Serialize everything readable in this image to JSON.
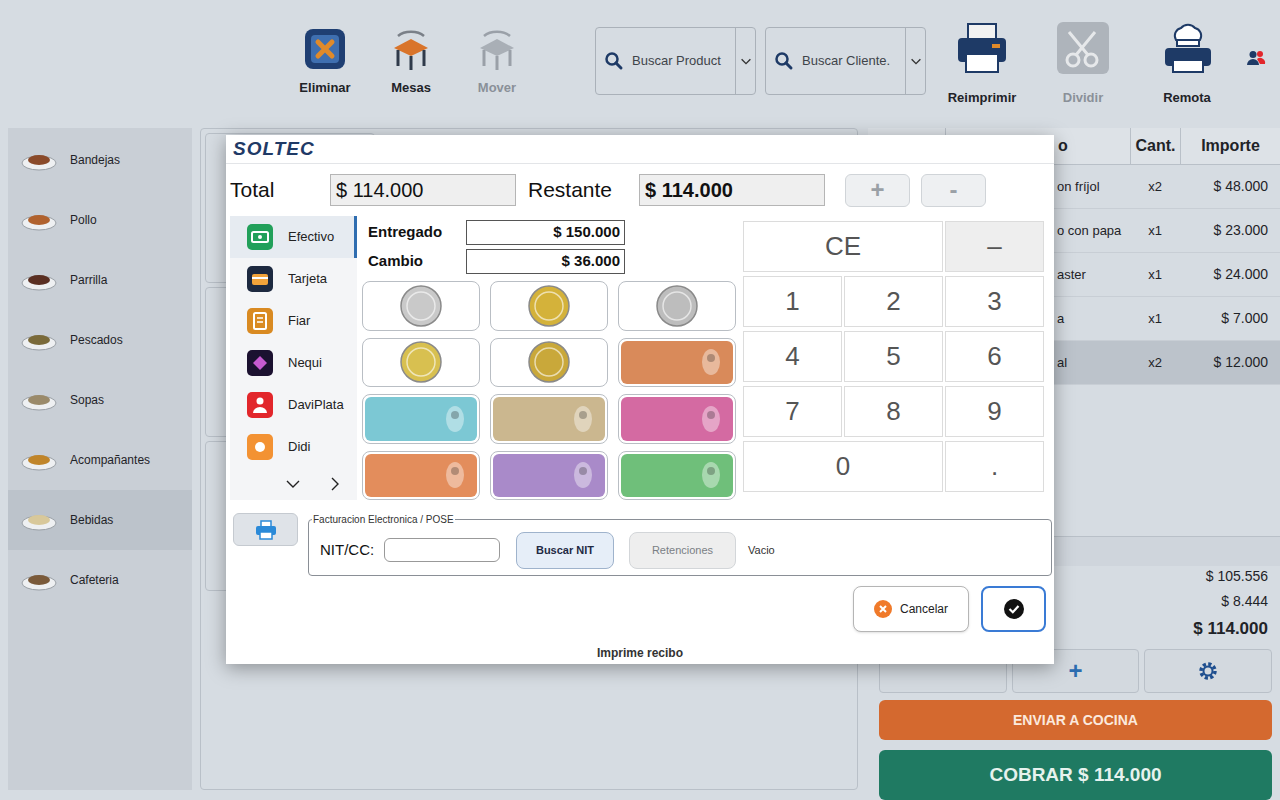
{
  "toolbar": {
    "buttons": [
      {
        "label": "Eliminar",
        "disabled": false
      },
      {
        "label": "Mesas",
        "disabled": false
      },
      {
        "label": "Mover",
        "disabled": true
      }
    ],
    "searches": [
      {
        "placeholder": "Buscar Product"
      },
      {
        "placeholder": "Buscar Cliente."
      }
    ],
    "actions": [
      {
        "label": "Reimprimir",
        "disabled": false
      },
      {
        "label": "Dividir",
        "disabled": true
      },
      {
        "label": "Remota",
        "disabled": false
      }
    ]
  },
  "categories": [
    {
      "label": "Bandejas",
      "selected": false
    },
    {
      "label": "Pollo",
      "selected": false
    },
    {
      "label": "Parrilla",
      "selected": false
    },
    {
      "label": "Pescados",
      "selected": false
    },
    {
      "label": "Sopas",
      "selected": false
    },
    {
      "label": "Acompañantes",
      "selected": false
    },
    {
      "label": "Bebidas",
      "selected": true
    },
    {
      "label": "Cafeteria",
      "selected": false
    }
  ],
  "order": {
    "columns": [
      "o",
      "Cant.",
      "Importe"
    ],
    "rows": [
      {
        "product": "on fríjol",
        "qty": "x2",
        "amount": "$ 48.000",
        "selected": false
      },
      {
        "product": "o con papa",
        "qty": "x1",
        "amount": "$ 23.000",
        "selected": false
      },
      {
        "product": "aster",
        "qty": "x1",
        "amount": "$ 24.000",
        "selected": false
      },
      {
        "product": "a",
        "qty": "x1",
        "amount": "$ 7.000",
        "selected": false
      },
      {
        "product": "al",
        "qty": "x2",
        "amount": "$ 12.000",
        "selected": true
      }
    ],
    "totals": [
      "$ 105.556",
      "$ 8.444",
      "$ 114.000"
    ],
    "add_button": "+",
    "send_button": "ENVIAR A COCINA",
    "charge_button": "COBRAR $ 114.000"
  },
  "dialog": {
    "logo": "SOLTEC",
    "total_label": "Total",
    "total": "$ 114.000",
    "remaining_label": "Restante",
    "remaining": "$ 114.000",
    "plus": {
      "label": "+",
      "disabled": true
    },
    "minus": {
      "label": "-",
      "disabled": true
    },
    "methods": [
      {
        "label": "Efectivo",
        "selected": true,
        "color": "#22a05a"
      },
      {
        "label": "Tarjeta",
        "selected": false,
        "color": "#1d2940"
      },
      {
        "label": "Fiar",
        "selected": false,
        "color": "#d98a22"
      },
      {
        "label": "Nequi",
        "selected": false,
        "color": "#1b1130"
      },
      {
        "label": "DaviPlata",
        "selected": false,
        "color": "#e2262b"
      },
      {
        "label": "Didi",
        "selected": false,
        "color": "#f39233"
      }
    ],
    "delivered_label": "Entregado",
    "delivered": "$ 150.000",
    "change_label": "Cambio",
    "change": "$ 36.000",
    "denominations": [
      {
        "kind": "coin",
        "color": "#c9c9c9"
      },
      {
        "kind": "coin",
        "color": "#d4b23a"
      },
      {
        "kind": "coin",
        "color": "#bdbdbd"
      },
      {
        "kind": "coin",
        "color": "#d8c050"
      },
      {
        "kind": "coin",
        "color": "#c9a83a"
      },
      {
        "kind": "bill",
        "color": "#d98a5a"
      },
      {
        "kind": "bill",
        "color": "#7cc8d4"
      },
      {
        "kind": "bill",
        "color": "#cbb78f"
      },
      {
        "kind": "bill",
        "color": "#d46aa2"
      },
      {
        "kind": "bill",
        "color": "#e38d5c"
      },
      {
        "kind": "bill",
        "color": "#a98ac9"
      },
      {
        "kind": "bill",
        "color": "#6fbf7a"
      }
    ],
    "keypad": [
      {
        "label": "CE",
        "kind": "wide"
      },
      {
        "label": "–",
        "kind": "shaded"
      },
      {
        "label": "1",
        "kind": "key"
      },
      {
        "label": "2",
        "kind": "key"
      },
      {
        "label": "3",
        "kind": "key"
      },
      {
        "label": "4",
        "kind": "key"
      },
      {
        "label": "5",
        "kind": "key"
      },
      {
        "label": "6",
        "kind": "key"
      },
      {
        "label": "7",
        "kind": "key"
      },
      {
        "label": "8",
        "kind": "key"
      },
      {
        "label": "9",
        "kind": "key"
      },
      {
        "label": "0",
        "kind": "wide"
      },
      {
        "label": ".",
        "kind": "key"
      }
    ],
    "invoice": {
      "legend": "Facturacion Electronica / POSE",
      "nit_label": "NIT/CC:",
      "search_button": "Buscar NIT",
      "retentions": {
        "label": "Retenciones",
        "disabled": true
      },
      "status": "Vacio"
    },
    "cancel": "Cancelar",
    "footer": "Imprime recibo"
  }
}
